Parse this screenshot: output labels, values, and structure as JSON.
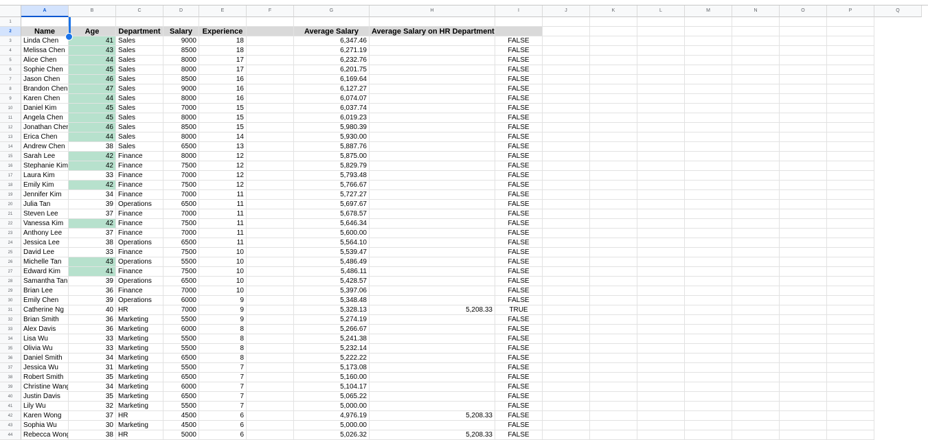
{
  "columns": [
    "A",
    "B",
    "C",
    "D",
    "E",
    "F",
    "G",
    "H",
    "I",
    "J",
    "K",
    "L",
    "M",
    "N",
    "O",
    "P",
    "Q"
  ],
  "selected_column": "A",
  "headers": {
    "name": "Name",
    "age": "Age",
    "department": "Department",
    "salary": "Salary",
    "experience": "Experience",
    "f": "",
    "avg_salary": "Average Salary",
    "avg_salary_hr": "Average Salary on HR Department",
    "i": ""
  },
  "rows": [
    {
      "row": 3,
      "name": "Linda Chen",
      "age": 41,
      "age_highlight": true,
      "dept": "Sales",
      "salary": 9000,
      "exp": 18,
      "avg": "6,347.46",
      "hr": "",
      "flag": "FALSE"
    },
    {
      "row": 4,
      "name": "Melissa Chen",
      "age": 43,
      "age_highlight": true,
      "dept": "Sales",
      "salary": 8500,
      "exp": 18,
      "avg": "6,271.19",
      "hr": "",
      "flag": "FALSE"
    },
    {
      "row": 5,
      "name": "Alice Chen",
      "age": 44,
      "age_highlight": true,
      "dept": "Sales",
      "salary": 8000,
      "exp": 17,
      "avg": "6,232.76",
      "hr": "",
      "flag": "FALSE"
    },
    {
      "row": 6,
      "name": "Sophie Chen",
      "age": 45,
      "age_highlight": true,
      "dept": "Sales",
      "salary": 8000,
      "exp": 17,
      "avg": "6,201.75",
      "hr": "",
      "flag": "FALSE"
    },
    {
      "row": 7,
      "name": "Jason Chen",
      "age": 46,
      "age_highlight": true,
      "dept": "Sales",
      "salary": 8500,
      "exp": 16,
      "avg": "6,169.64",
      "hr": "",
      "flag": "FALSE"
    },
    {
      "row": 8,
      "name": "Brandon Chen",
      "age": 47,
      "age_highlight": true,
      "dept": "Sales",
      "salary": 9000,
      "exp": 16,
      "avg": "6,127.27",
      "hr": "",
      "flag": "FALSE"
    },
    {
      "row": 9,
      "name": "Karen Chen",
      "age": 44,
      "age_highlight": true,
      "dept": "Sales",
      "salary": 8000,
      "exp": 16,
      "avg": "6,074.07",
      "hr": "",
      "flag": "FALSE"
    },
    {
      "row": 10,
      "name": "Daniel Kim",
      "age": 45,
      "age_highlight": true,
      "dept": "Sales",
      "salary": 7000,
      "exp": 15,
      "avg": "6,037.74",
      "hr": "",
      "flag": "FALSE"
    },
    {
      "row": 11,
      "name": "Angela Chen",
      "age": 45,
      "age_highlight": true,
      "dept": "Sales",
      "salary": 8000,
      "exp": 15,
      "avg": "6,019.23",
      "hr": "",
      "flag": "FALSE"
    },
    {
      "row": 12,
      "name": "Jonathan Chen",
      "age": 46,
      "age_highlight": true,
      "dept": "Sales",
      "salary": 8500,
      "exp": 15,
      "avg": "5,980.39",
      "hr": "",
      "flag": "FALSE"
    },
    {
      "row": 13,
      "name": "Erica Chen",
      "age": 44,
      "age_highlight": true,
      "dept": "Sales",
      "salary": 8000,
      "exp": 14,
      "avg": "5,930.00",
      "hr": "",
      "flag": "FALSE"
    },
    {
      "row": 14,
      "name": "Andrew Chen",
      "age": 38,
      "age_highlight": false,
      "dept": "Sales",
      "salary": 6500,
      "exp": 13,
      "avg": "5,887.76",
      "hr": "",
      "flag": "FALSE"
    },
    {
      "row": 15,
      "name": "Sarah Lee",
      "age": 42,
      "age_highlight": true,
      "dept": "Finance",
      "salary": 8000,
      "exp": 12,
      "avg": "5,875.00",
      "hr": "",
      "flag": "FALSE"
    },
    {
      "row": 16,
      "name": "Stephanie Kim",
      "age": 42,
      "age_highlight": true,
      "dept": "Finance",
      "salary": 7500,
      "exp": 12,
      "avg": "5,829.79",
      "hr": "",
      "flag": "FALSE"
    },
    {
      "row": 17,
      "name": "Laura Kim",
      "age": 33,
      "age_highlight": false,
      "dept": "Finance",
      "salary": 7000,
      "exp": 12,
      "avg": "5,793.48",
      "hr": "",
      "flag": "FALSE"
    },
    {
      "row": 18,
      "name": "Emily Kim",
      "age": 42,
      "age_highlight": true,
      "dept": "Finance",
      "salary": 7500,
      "exp": 12,
      "avg": "5,766.67",
      "hr": "",
      "flag": "FALSE"
    },
    {
      "row": 19,
      "name": "Jennifer Kim",
      "age": 34,
      "age_highlight": false,
      "dept": "Finance",
      "salary": 7000,
      "exp": 11,
      "avg": "5,727.27",
      "hr": "",
      "flag": "FALSE"
    },
    {
      "row": 20,
      "name": "Julia Tan",
      "age": 39,
      "age_highlight": false,
      "dept": "Operations",
      "salary": 6500,
      "exp": 11,
      "avg": "5,697.67",
      "hr": "",
      "flag": "FALSE"
    },
    {
      "row": 21,
      "name": "Steven Lee",
      "age": 37,
      "age_highlight": false,
      "dept": "Finance",
      "salary": 7000,
      "exp": 11,
      "avg": "5,678.57",
      "hr": "",
      "flag": "FALSE"
    },
    {
      "row": 22,
      "name": "Vanessa Kim",
      "age": 42,
      "age_highlight": true,
      "dept": "Finance",
      "salary": 7500,
      "exp": 11,
      "avg": "5,646.34",
      "hr": "",
      "flag": "FALSE"
    },
    {
      "row": 23,
      "name": "Anthony Lee",
      "age": 37,
      "age_highlight": false,
      "dept": "Finance",
      "salary": 7000,
      "exp": 11,
      "avg": "5,600.00",
      "hr": "",
      "flag": "FALSE"
    },
    {
      "row": 24,
      "name": "Jessica Lee",
      "age": 38,
      "age_highlight": false,
      "dept": "Operations",
      "salary": 6500,
      "exp": 11,
      "avg": "5,564.10",
      "hr": "",
      "flag": "FALSE"
    },
    {
      "row": 25,
      "name": "David Lee",
      "age": 33,
      "age_highlight": false,
      "dept": "Finance",
      "salary": 7500,
      "exp": 10,
      "avg": "5,539.47",
      "hr": "",
      "flag": "FALSE"
    },
    {
      "row": 26,
      "name": "Michelle Tan",
      "age": 43,
      "age_highlight": true,
      "dept": "Operations",
      "salary": 5500,
      "exp": 10,
      "avg": "5,486.49",
      "hr": "",
      "flag": "FALSE"
    },
    {
      "row": 27,
      "name": "Edward Kim",
      "age": 41,
      "age_highlight": true,
      "dept": "Finance",
      "salary": 7500,
      "exp": 10,
      "avg": "5,486.11",
      "hr": "",
      "flag": "FALSE"
    },
    {
      "row": 28,
      "name": "Samantha Tan",
      "age": 39,
      "age_highlight": false,
      "dept": "Operations",
      "salary": 6500,
      "exp": 10,
      "avg": "5,428.57",
      "hr": "",
      "flag": "FALSE"
    },
    {
      "row": 29,
      "name": "Brian Lee",
      "age": 36,
      "age_highlight": false,
      "dept": "Finance",
      "salary": 7000,
      "exp": 10,
      "avg": "5,397.06",
      "hr": "",
      "flag": "FALSE"
    },
    {
      "row": 30,
      "name": "Emily Chen",
      "age": 39,
      "age_highlight": false,
      "dept": "Operations",
      "salary": 6000,
      "exp": 9,
      "avg": "5,348.48",
      "hr": "",
      "flag": "FALSE"
    },
    {
      "row": 31,
      "name": "Catherine Ng",
      "age": 40,
      "age_highlight": false,
      "dept": "HR",
      "salary": 7000,
      "exp": 9,
      "avg": "5,328.13",
      "hr": "5,208.33",
      "flag": "TRUE"
    },
    {
      "row": 32,
      "name": "Brian Smith",
      "age": 36,
      "age_highlight": false,
      "dept": "Marketing",
      "salary": 5500,
      "exp": 9,
      "avg": "5,274.19",
      "hr": "",
      "flag": "FALSE"
    },
    {
      "row": 33,
      "name": "Alex Davis",
      "age": 36,
      "age_highlight": false,
      "dept": "Marketing",
      "salary": 6000,
      "exp": 8,
      "avg": "5,266.67",
      "hr": "",
      "flag": "FALSE"
    },
    {
      "row": 34,
      "name": "Lisa Wu",
      "age": 33,
      "age_highlight": false,
      "dept": "Marketing",
      "salary": 5500,
      "exp": 8,
      "avg": "5,241.38",
      "hr": "",
      "flag": "FALSE"
    },
    {
      "row": 35,
      "name": "Olivia Wu",
      "age": 33,
      "age_highlight": false,
      "dept": "Marketing",
      "salary": 5500,
      "exp": 8,
      "avg": "5,232.14",
      "hr": "",
      "flag": "FALSE"
    },
    {
      "row": 36,
      "name": "Daniel Smith",
      "age": 34,
      "age_highlight": false,
      "dept": "Marketing",
      "salary": 6500,
      "exp": 8,
      "avg": "5,222.22",
      "hr": "",
      "flag": "FALSE"
    },
    {
      "row": 37,
      "name": "Jessica Wu",
      "age": 31,
      "age_highlight": false,
      "dept": "Marketing",
      "salary": 5500,
      "exp": 7,
      "avg": "5,173.08",
      "hr": "",
      "flag": "FALSE"
    },
    {
      "row": 38,
      "name": "Robert Smith",
      "age": 35,
      "age_highlight": false,
      "dept": "Marketing",
      "salary": 6500,
      "exp": 7,
      "avg": "5,160.00",
      "hr": "",
      "flag": "FALSE"
    },
    {
      "row": 39,
      "name": "Christine Wang",
      "age": 34,
      "age_highlight": false,
      "dept": "Marketing",
      "salary": 6000,
      "exp": 7,
      "avg": "5,104.17",
      "hr": "",
      "flag": "FALSE"
    },
    {
      "row": 40,
      "name": "Justin Davis",
      "age": 35,
      "age_highlight": false,
      "dept": "Marketing",
      "salary": 6500,
      "exp": 7,
      "avg": "5,065.22",
      "hr": "",
      "flag": "FALSE"
    },
    {
      "row": 41,
      "name": "Lily Wu",
      "age": 32,
      "age_highlight": false,
      "dept": "Marketing",
      "salary": 5500,
      "exp": 7,
      "avg": "5,000.00",
      "hr": "",
      "flag": "FALSE"
    },
    {
      "row": 42,
      "name": "Karen Wong",
      "age": 37,
      "age_highlight": false,
      "dept": "HR",
      "salary": 4500,
      "exp": 6,
      "avg": "4,976.19",
      "hr": "5,208.33",
      "flag": "FALSE"
    },
    {
      "row": 43,
      "name": "Sophia Wu",
      "age": 30,
      "age_highlight": false,
      "dept": "Marketing",
      "salary": 4500,
      "exp": 6,
      "avg": "5,000.00",
      "hr": "",
      "flag": "FALSE"
    },
    {
      "row": 44,
      "name": "Rebecca Wong",
      "age": 38,
      "age_highlight": false,
      "dept": "HR",
      "salary": 5000,
      "exp": 6,
      "avg": "5,026.32",
      "hr": "5,208.33",
      "flag": "FALSE"
    }
  ],
  "colors": {
    "highlight_green": "#b7e1cd",
    "header_gray": "#d9d9d9",
    "selection_blue": "#1a73e8"
  }
}
